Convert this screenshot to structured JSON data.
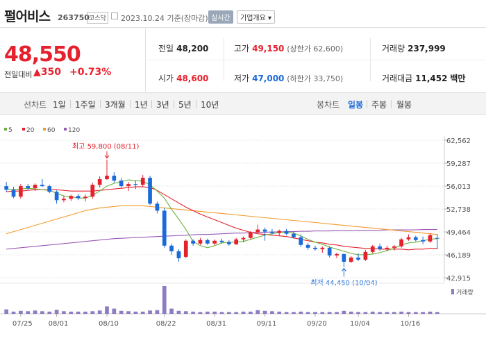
{
  "header": {
    "name": "펄어비스",
    "code": "263750",
    "market": "코스닥",
    "date": "2023.10.24 기준(장마감)",
    "realtime_label": "실시간",
    "overview_label": "기업개요 ▾"
  },
  "price": {
    "current": "48,550",
    "change_label": "전일대비",
    "change_arrow": "▲",
    "change": "350",
    "change_pct": "+0.73%"
  },
  "stats": {
    "prev_label": "전일",
    "prev": "48,200",
    "open_label": "시가",
    "open": "48,600",
    "high_label": "고가",
    "high": "49,150",
    "upper_limit": "(상한가 62,600)",
    "low_label": "저가",
    "low": "47,000",
    "lower_limit": "(하한가 33,750)",
    "volume_label": "거래량",
    "volume": "237,999",
    "amount_label": "거래대금",
    "amount": "11,452",
    "amount_unit": "백만"
  },
  "tabs": {
    "chart_label": "선차트",
    "periods": [
      "1일",
      "1주일",
      "3개월",
      "1년",
      "3년",
      "5년",
      "10년"
    ],
    "candle_label": "봉차트",
    "candles": [
      "일봉",
      "주봉",
      "월봉"
    ],
    "candle_selected": "일봉"
  },
  "colors": {
    "up": "#e5212d",
    "down": "#1a6ad9",
    "ma5": "#6db33f",
    "ma20": "#e5212d",
    "ma60": "#f39a2e",
    "ma120": "#9b59b6",
    "volume": "#8e7cc3"
  },
  "chart_data": {
    "type": "candlestick",
    "legend": [
      {
        "name": "5",
        "color": "#6db33f"
      },
      {
        "name": "20",
        "color": "#e5212d"
      },
      {
        "name": "60",
        "color": "#f39a2e"
      },
      {
        "name": "120",
        "color": "#9b59b6"
      }
    ],
    "y_ticks": [
      "62,562",
      "59,287",
      "56,013",
      "52,738",
      "49,464",
      "46,189",
      "42,915"
    ],
    "ylim": [
      42915,
      62562
    ],
    "x_ticks": [
      {
        "label": "07/25",
        "i": 2
      },
      {
        "label": "08/01",
        "i": 7
      },
      {
        "label": "08/10",
        "i": 14
      },
      {
        "label": "08/22",
        "i": 22
      },
      {
        "label": "08/31",
        "i": 29
      },
      {
        "label": "09/11",
        "i": 36
      },
      {
        "label": "09/20",
        "i": 43
      },
      {
        "label": "10/04",
        "i": 49
      },
      {
        "label": "10/16",
        "i": 56
      }
    ],
    "high_annotation": "최고 59,800 (08/11)",
    "low_annotation": "최저 44,450 (10/04)",
    "volume_label": "거래량",
    "candles": [
      [
        56000,
        56600,
        55200,
        55500
      ],
      [
        55500,
        55900,
        54300,
        54500
      ],
      [
        54500,
        56300,
        54200,
        56000
      ],
      [
        56000,
        56300,
        55400,
        55700
      ],
      [
        55700,
        56400,
        55300,
        56200
      ],
      [
        56200,
        57000,
        55900,
        56000
      ],
      [
        56000,
        56200,
        55000,
        55200
      ],
      [
        55200,
        55400,
        53500,
        54000
      ],
      [
        54000,
        54600,
        53700,
        54200
      ],
      [
        54200,
        54800,
        53900,
        54600
      ],
      [
        54600,
        54900,
        54000,
        54300
      ],
      [
        54300,
        54800,
        53800,
        54500
      ],
      [
        54500,
        56500,
        54200,
        56200
      ],
      [
        56200,
        57400,
        55800,
        57000
      ],
      [
        57000,
        59800,
        56900,
        57500
      ],
      [
        57500,
        58000,
        56500,
        56800
      ],
      [
        56800,
        57200,
        55800,
        56000
      ],
      [
        56000,
        56600,
        55300,
        56300
      ],
      [
        56300,
        56800,
        55600,
        56200
      ],
      [
        56200,
        57600,
        55900,
        57200
      ],
      [
        57200,
        57500,
        53300,
        53500
      ],
      [
        53500,
        53800,
        52100,
        52500
      ],
      [
        52500,
        52900,
        47200,
        47500
      ],
      [
        47500,
        47800,
        46200,
        46700
      ],
      [
        46700,
        47000,
        45200,
        45700
      ],
      [
        45900,
        48400,
        45700,
        48200
      ],
      [
        48200,
        48400,
        47500,
        47800
      ],
      [
        47800,
        48600,
        47600,
        48300
      ],
      [
        48300,
        48500,
        47600,
        47800
      ],
      [
        47800,
        48400,
        47600,
        48200
      ],
      [
        48200,
        48500,
        47800,
        48000
      ],
      [
        48000,
        48300,
        47500,
        47700
      ],
      [
        47700,
        48600,
        47600,
        48400
      ],
      [
        48400,
        48800,
        48000,
        48600
      ],
      [
        48600,
        49600,
        48400,
        49400
      ],
      [
        49400,
        50500,
        49200,
        49800
      ],
      [
        49800,
        50100,
        48200,
        49500
      ],
      [
        49500,
        49900,
        49100,
        49300
      ],
      [
        49300,
        49800,
        48900,
        49600
      ],
      [
        49600,
        49900,
        49000,
        49200
      ],
      [
        49200,
        49500,
        48500,
        48700
      ],
      [
        48700,
        49100,
        47300,
        47600
      ],
      [
        47600,
        47900,
        46900,
        47200
      ],
      [
        47200,
        47500,
        46800,
        47000
      ],
      [
        47000,
        47400,
        46500,
        47200
      ],
      [
        47200,
        47400,
        45800,
        46100
      ],
      [
        46100,
        46500,
        45700,
        46300
      ],
      [
        46300,
        46400,
        44450,
        45200
      ],
      [
        45200,
        46000,
        45000,
        45800
      ],
      [
        45800,
        46400,
        45300,
        45500
      ],
      [
        45500,
        46900,
        45300,
        46600
      ],
      [
        46600,
        47600,
        46400,
        47400
      ],
      [
        47400,
        47800,
        46800,
        47000
      ],
      [
        47000,
        47500,
        46700,
        47200
      ],
      [
        47200,
        47600,
        46800,
        47400
      ],
      [
        47400,
        48600,
        47200,
        48400
      ],
      [
        48400,
        49100,
        48200,
        48700
      ],
      [
        48700,
        48900,
        48100,
        48300
      ],
      [
        48300,
        48800,
        47700,
        48100
      ],
      [
        48100,
        49300,
        47900,
        49000
      ],
      [
        48600,
        49150,
        47000,
        48550
      ]
    ],
    "ma5": [
      55600,
      55500,
      55600,
      55700,
      55600,
      55500,
      55400,
      55000,
      54600,
      54500,
      54300,
      54300,
      54700,
      55300,
      56000,
      56400,
      56700,
      56900,
      56800,
      56700,
      56200,
      55300,
      54300,
      52700,
      51300,
      49800,
      48100,
      47500,
      47200,
      47500,
      47900,
      48000,
      48000,
      48100,
      48400,
      48700,
      49000,
      49200,
      49400,
      49400,
      49300,
      48900,
      48400,
      48000,
      47700,
      47300,
      47000,
      46700,
      46400,
      46200,
      46200,
      46300,
      46500,
      46800,
      47100,
      47600,
      47900,
      48000,
      48200,
      48400,
      48500
    ],
    "ma20": [
      55200,
      55300,
      55300,
      55400,
      55500,
      55500,
      55500,
      55500,
      55400,
      55300,
      55300,
      55300,
      55300,
      55400,
      55500,
      55600,
      55700,
      55800,
      55900,
      55900,
      55800,
      55400,
      54800,
      54200,
      53600,
      53000,
      52500,
      52000,
      51600,
      51200,
      50800,
      50400,
      50000,
      49700,
      49400,
      49200,
      49100,
      49000,
      48900,
      48800,
      48600,
      48400,
      48200,
      48000,
      47900,
      47700,
      47600,
      47400,
      47300,
      47200,
      47100,
      47100,
      47000,
      47000,
      47000,
      47000,
      46900,
      47000,
      47000,
      47100,
      47100
    ],
    "ma60": [
      49200,
      49500,
      49800,
      50100,
      50400,
      50700,
      51000,
      51300,
      51600,
      51900,
      52200,
      52500,
      52700,
      52900,
      53000,
      53100,
      53200,
      53200,
      53200,
      53200,
      53100,
      53000,
      52900,
      52800,
      52700,
      52600,
      52500,
      52400,
      52300,
      52200,
      52100,
      52000,
      51900,
      51800,
      51700,
      51600,
      51500,
      51400,
      51300,
      51200,
      51100,
      51000,
      50900,
      50800,
      50700,
      50600,
      50500,
      50400,
      50300,
      50200,
      50100,
      50000,
      49900,
      49800,
      49700,
      49600,
      49500,
      49400,
      49300,
      49200,
      49100
    ],
    "ma120": [
      47000,
      47100,
      47200,
      47300,
      47400,
      47500,
      47600,
      47700,
      47800,
      47900,
      48000,
      48100,
      48200,
      48300,
      48400,
      48500,
      48550,
      48600,
      48650,
      48700,
      48750,
      48800,
      48850,
      48900,
      48950,
      49000,
      49050,
      49100,
      49100,
      49150,
      49200,
      49250,
      49300,
      49300,
      49350,
      49400,
      49400,
      49450,
      49450,
      49500,
      49500,
      49550,
      49550,
      49600,
      49600,
      49600,
      49650,
      49650,
      49650,
      49700,
      49700,
      49700,
      49700,
      49750,
      49750,
      49750,
      49750,
      49750,
      49800,
      49800,
      49800
    ],
    "volume": [
      12,
      6,
      8,
      7,
      9,
      7,
      6,
      11,
      7,
      6,
      6,
      6,
      7,
      9,
      20,
      14,
      8,
      7,
      6,
      6,
      9,
      10,
      75,
      14,
      8,
      7,
      6,
      5,
      6,
      6,
      5,
      5,
      5,
      6,
      6,
      10,
      8,
      7,
      6,
      5,
      5,
      6,
      5,
      5,
      5,
      5,
      5,
      8,
      6,
      5,
      5,
      6,
      5,
      5,
      5,
      6,
      5,
      5,
      5,
      6,
      5
    ]
  }
}
